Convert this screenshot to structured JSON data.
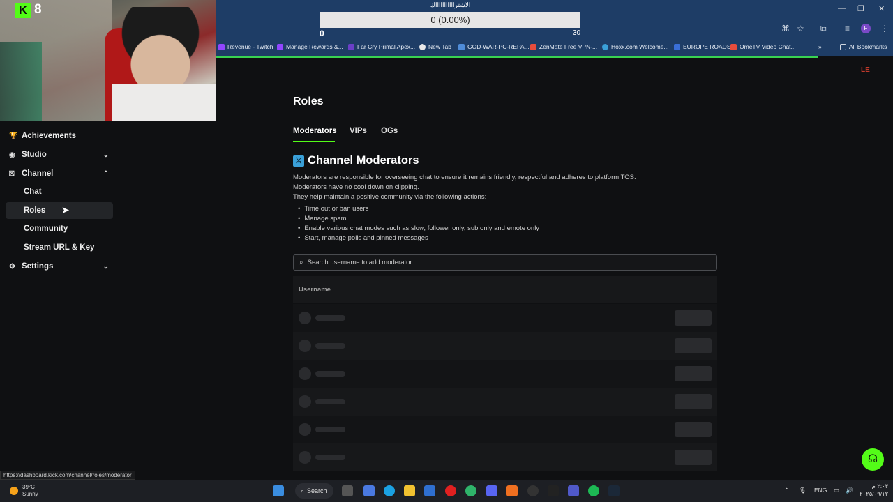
{
  "webcam": {
    "badge_letter": "K",
    "viewer_count": "8"
  },
  "goal": {
    "title": "الاشتراااااااااااك",
    "progress_text": "0 (0.00%)",
    "min": "0",
    "max": "30"
  },
  "bookmarks": [
    {
      "label": "Revenue - Twitch",
      "color": "#9146ff"
    },
    {
      "label": "Manage Rewards &...",
      "color": "#9146ff"
    },
    {
      "label": "Far Cry Primal Apex...",
      "color": "#6a3fc7"
    },
    {
      "label": "New Tab",
      "color": "#e8e8e8"
    },
    {
      "label": "GOD-WAR-PC-REPA...",
      "color": "#4f8cd8"
    },
    {
      "label": "ZenMate Free VPN-...",
      "color": "#e74c3c"
    },
    {
      "label": "Hoxx.com Welcome...",
      "color": "#3aa0d8"
    },
    {
      "label": "EUROPE ROADS",
      "color": "#3a6fd8"
    },
    {
      "label": "OmeTV Video Chat...",
      "color": "#e74c3c"
    },
    {
      "label": "All Bookmarks",
      "color": "#cfd6e0"
    }
  ],
  "sidebar": {
    "items": [
      {
        "label": "Achievements",
        "icon": "trophy-icon",
        "glyph": "🏆"
      },
      {
        "label": "Studio",
        "icon": "studio-icon",
        "glyph": "◉"
      },
      {
        "label": "Channel",
        "icon": "channel-icon",
        "glyph": "⛝"
      },
      {
        "label": "Chat"
      },
      {
        "label": "Roles"
      },
      {
        "label": "Community"
      },
      {
        "label": "Stream URL & Key"
      },
      {
        "label": "Settings",
        "icon": "gear-icon",
        "glyph": "⚙"
      }
    ]
  },
  "page": {
    "title": "Roles",
    "tabs": [
      "Moderators",
      "VIPs",
      "OGs"
    ],
    "section_title": "Channel Moderators",
    "desc_lines": [
      "Moderators are responsible for overseeing chat to ensure it remains friendly, respectful and adheres to platform TOS.",
      "Moderators have no cool down on clipping.",
      "They help maintain a positive community via the following actions:"
    ],
    "bullets": [
      "Time out or ban users",
      "Manage spam",
      "Enable various chat modes such as slow, follower only, sub only and emote only",
      "Start, manage polls and pinned messages"
    ],
    "search_placeholder": "Search username to add moderator",
    "table_header": "Username"
  },
  "status_url": "https://dashboard.kick.com/channel/roles/moderator",
  "logo_text": "LE",
  "taskbar": {
    "weather_temp": "39°C",
    "weather_desc": "Sunny",
    "search_label": "Search",
    "lang": "ENG",
    "time": "٢:٠٣ م",
    "date": "٢٠٢٥/٠٩/١٢"
  },
  "colors": {
    "accent": "#53fc18",
    "browser_bar": "#1e3d66",
    "background": "#0f1012"
  }
}
